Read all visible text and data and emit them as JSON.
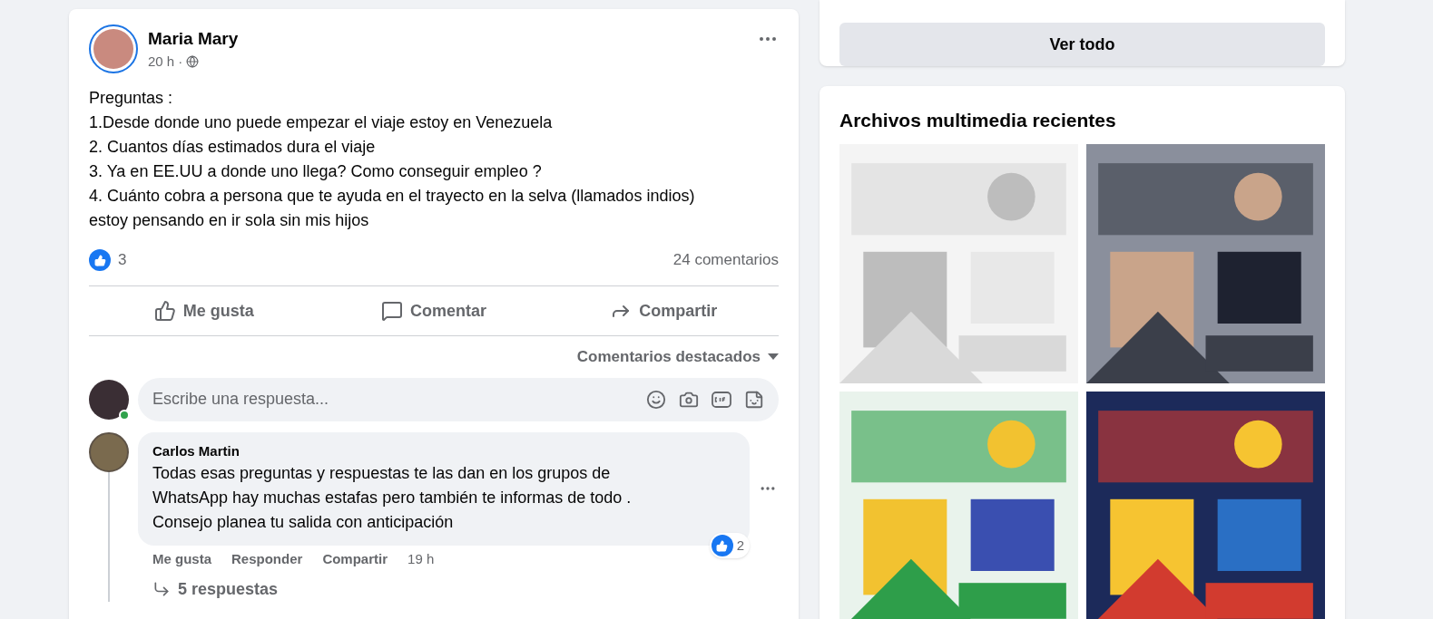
{
  "post": {
    "author": "Maria Mary",
    "time": "20 h ·",
    "text_lines": [
      "Preguntas :",
      "1.Desde donde uno puede empezar el viaje estoy en Venezuela",
      "2. Cuantos días estimados dura el viaje",
      "3. Ya en EE.UU a donde uno llega? Como conseguir empleo ?",
      "4. Cuánto cobra a persona que te ayuda en el trayecto en la selva (llamados indios)",
      "estoy pensando en ir sola sin mis hijos"
    ],
    "reactions": "3",
    "comments_count": "24 comentarios",
    "actions": [
      {
        "kind": "like",
        "label": "Me gusta"
      },
      {
        "kind": "comment",
        "label": "Comentar"
      },
      {
        "kind": "share",
        "label": "Compartir"
      }
    ],
    "sort": "Comentarios destacados",
    "reply_box": {
      "placeholder": "Escribe una respuesta...",
      "online": true
    },
    "comments": [
      {
        "author": "Carlos Martin",
        "text_lines": [
          "Todas esas preguntas y respuestas te las dan en los grupos de",
          "WhatsApp hay muchas estafas pero también te informas de todo .",
          "Consejo planea tu salida con anticipación"
        ],
        "reactions": "2",
        "actions": [
          "Me gusta",
          "Responder",
          "Compartir"
        ],
        "time": "19 h",
        "replies": "5 respuestas"
      }
    ]
  },
  "sidebar": {
    "see_all": "Ver todo",
    "media_title": "Archivos multimedia recientes"
  }
}
